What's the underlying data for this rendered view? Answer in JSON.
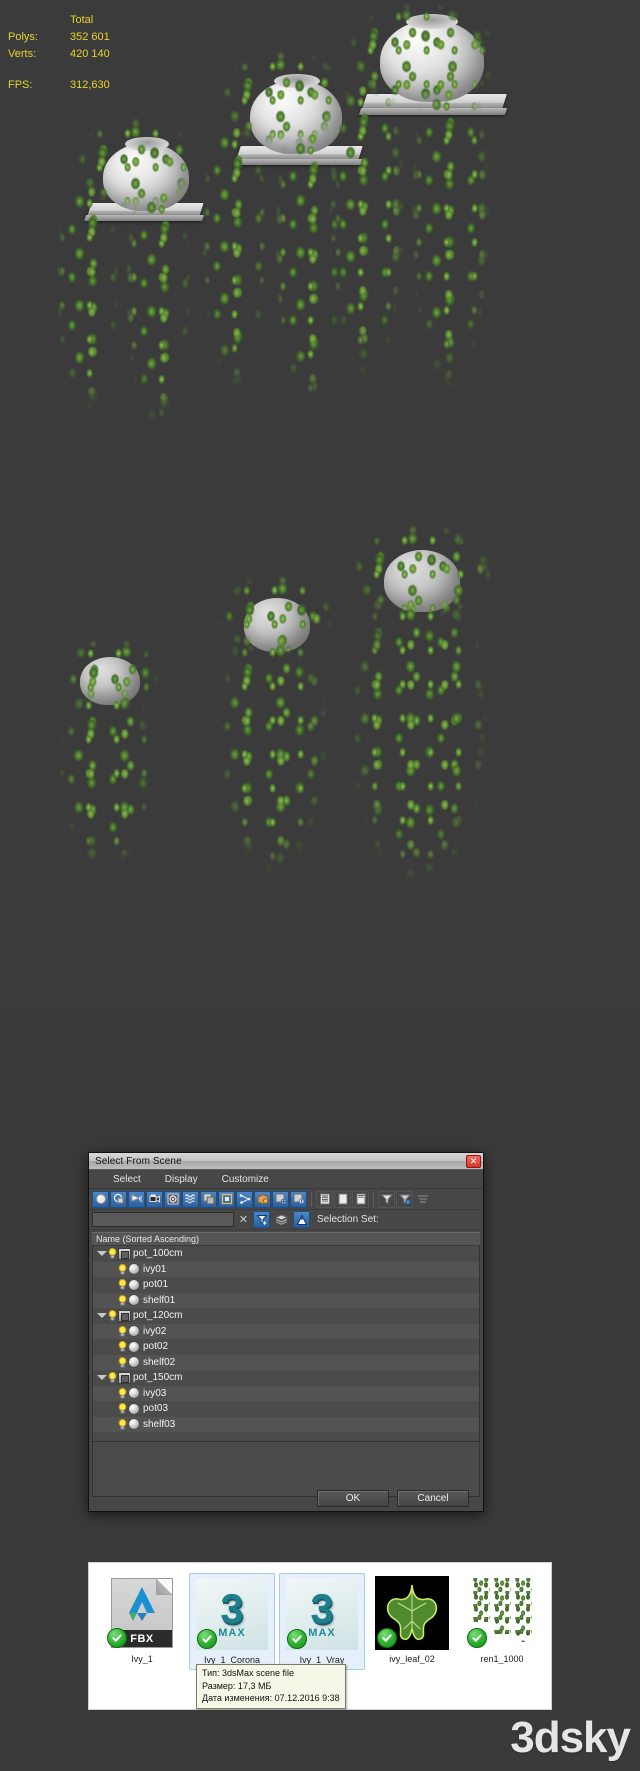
{
  "stats": {
    "header": "Total",
    "rows": [
      {
        "label": "Polys:",
        "value": "352 601"
      },
      {
        "label": "Verts:",
        "value": "420 140"
      }
    ],
    "fps_label": "FPS:",
    "fps_value": "312,630",
    "color": "#e8d32a"
  },
  "dialog": {
    "title": "Select From Scene",
    "close_glyph": "✕",
    "menu": [
      {
        "label": "Select"
      },
      {
        "label": "Display"
      },
      {
        "label": "Customize"
      }
    ],
    "toolbar_icons": [
      "display-geometry-icon",
      "display-shapes-icon",
      "display-lights-icon",
      "display-cameras-icon",
      "display-helpers-icon",
      "display-space-warps-icon",
      "display-groups-icon",
      "display-xrefs-icon",
      "display-bones-icon",
      "display-containers-icon",
      "display-particle-systems-icon",
      "display-rendered-icon",
      "list-types-icon",
      "expand-all-icon",
      "collapse-all-icon",
      "select-none-icon"
    ],
    "filter_icons": [
      "filter-funnel-icon",
      "filter-funnel-clear-icon",
      "lock-funnel-icon"
    ],
    "find_value": "",
    "find_placeholder": "",
    "clear_glyph": "✕",
    "selection_set_label": "Selection Set:",
    "column_header": "Name (Sorted Ascending)",
    "tree": [
      {
        "name": "pot_100cm",
        "type": "group",
        "children": [
          {
            "name": "ivy01",
            "type": "object"
          },
          {
            "name": "pot01",
            "type": "object"
          },
          {
            "name": "shelf01",
            "type": "object"
          }
        ]
      },
      {
        "name": "pot_120cm",
        "type": "group",
        "children": [
          {
            "name": "ivy02",
            "type": "object"
          },
          {
            "name": "pot02",
            "type": "object"
          },
          {
            "name": "shelf02",
            "type": "object"
          }
        ]
      },
      {
        "name": "pot_150cm",
        "type": "group",
        "children": [
          {
            "name": "ivy03",
            "type": "object"
          },
          {
            "name": "pot03",
            "type": "object"
          },
          {
            "name": "shelf03",
            "type": "object"
          }
        ]
      }
    ],
    "ok_label": "OK",
    "cancel_label": "Cancel"
  },
  "explorer": {
    "items": [
      {
        "caption": "Ivy_1",
        "kind": "fbx",
        "badge_label": "FBX",
        "selected": false,
        "checked": true
      },
      {
        "caption": "Ivy_1_Corona",
        "kind": "max",
        "badge_label": "MAX",
        "digit": "3",
        "selected": true,
        "checked": true
      },
      {
        "caption": "Ivy_1_Vray",
        "kind": "max",
        "badge_label": "MAX",
        "digit": "3",
        "selected": true,
        "checked": true
      },
      {
        "caption": "ivy_leaf_02",
        "kind": "leaf",
        "selected": false,
        "checked": true
      },
      {
        "caption": "ren1_1000",
        "kind": "render",
        "selected": false,
        "checked": true
      }
    ]
  },
  "tooltip": {
    "lines": [
      "Тип: 3dsMax scene file",
      "Размер: 17,3 МБ",
      "Дата изменения: 07.12.2016 9:38"
    ]
  },
  "watermark": {
    "text": "3dsky"
  }
}
